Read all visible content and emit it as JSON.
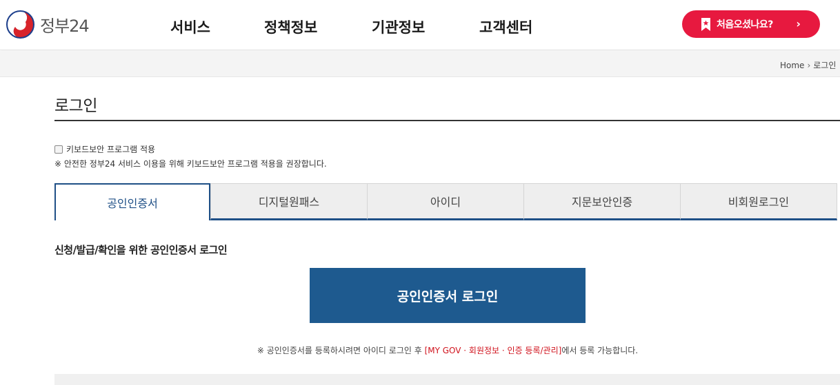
{
  "header": {
    "logo_text": "정부24",
    "nav": [
      "서비스",
      "정책정보",
      "기관정보",
      "고객센터"
    ],
    "first_visit_button": "처음오셨나요?",
    "first_visit_chevron": "›",
    "accent_color": "#e7193f"
  },
  "breadcrumb": {
    "home": "Home",
    "separator": "›",
    "current": "로그인"
  },
  "page": {
    "title": "로그인",
    "keyboard_security_label": "키보드보안 프로그램 적용",
    "keyboard_security_note": "※ 안전한 정부24 서비스 이용을 위해 키보드보안 프로그램 적용을 권장합니다."
  },
  "tabs": [
    {
      "label": "공인인증서",
      "active": true
    },
    {
      "label": "디지털원패스",
      "active": false
    },
    {
      "label": "아이디",
      "active": false
    },
    {
      "label": "지문보안인증",
      "active": false
    },
    {
      "label": "비회원로그인",
      "active": false
    }
  ],
  "content": {
    "section_title": "신청/발급/확인을 위한 공인인증서 로그인",
    "login_button": "공인인증서 로그인",
    "notice_prefix": "※ 공인인증서를 등록하시려면 아이디 로그인 후 ",
    "notice_link": "[MY GOV · 회원정보 · 인증 등록/관리]",
    "notice_suffix": "에서 등록 가능합니다.",
    "primary_color": "#1e5a8f"
  }
}
